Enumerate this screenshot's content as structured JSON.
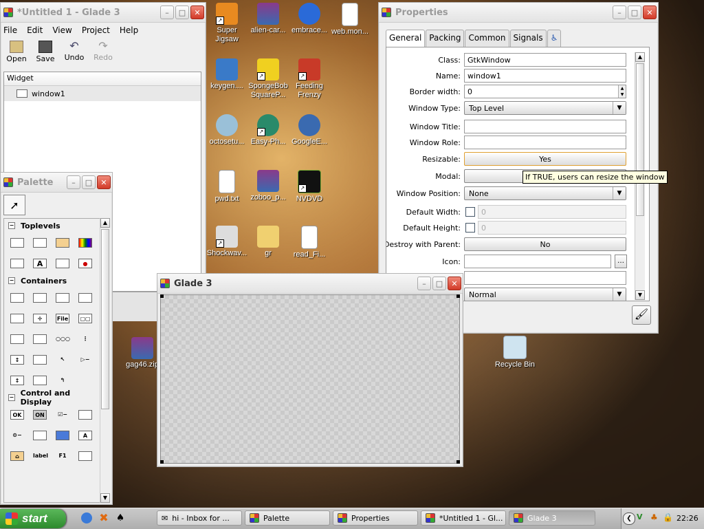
{
  "desktop": {
    "icons": [
      {
        "label": "Super Jigsaw",
        "x": 0
      },
      {
        "label": "alien-car...",
        "x": 0
      },
      {
        "label": "embrace...",
        "x": 0
      },
      {
        "label": "web.mon...",
        "x": 0
      },
      {
        "label": "keygen....",
        "x": 0
      },
      {
        "label": "SpongeBob SquareP...",
        "x": 0
      },
      {
        "label": "Feeding Frenzy",
        "x": 0
      },
      {
        "label": "octosetu...",
        "x": 0
      },
      {
        "label": "Easy-Ph...",
        "x": 0
      },
      {
        "label": "GoogleE...",
        "x": 0
      },
      {
        "label": "pwd.txt",
        "x": 0
      },
      {
        "label": "zoboo_p...",
        "x": 0
      },
      {
        "label": "NVDVD",
        "x": 0
      },
      {
        "label": "Shockwav...",
        "x": 0
      },
      {
        "label": "gr",
        "x": 0
      },
      {
        "label": "read_Fi...",
        "x": 0
      },
      {
        "label": "gag46.zip",
        "x": 0
      },
      {
        "label": "Recycle Bin",
        "x": 0
      }
    ]
  },
  "main_window": {
    "title": "*Untitled 1 - Glade 3",
    "menu": [
      "File",
      "Edit",
      "View",
      "Project",
      "Help"
    ],
    "toolbar": [
      "Open",
      "Save",
      "Undo",
      "Redo"
    ],
    "tree_header": "Widget",
    "tree_item": "window1"
  },
  "palette": {
    "title": "Palette",
    "sections": [
      "Toplevels",
      "Containers",
      "Control and Display"
    ],
    "file_label": "File",
    "ok_label": "OK",
    "on_label": "ON",
    "label_label": "label",
    "f1_label": "F1"
  },
  "properties": {
    "title": "Properties",
    "tabs": [
      "General",
      "Packing",
      "Common",
      "Signals"
    ],
    "rows": {
      "class_label": "Class:",
      "class_value": "GtkWindow",
      "name_label": "Name:",
      "name_value": "window1",
      "border_label": "Border width:",
      "border_value": "0",
      "wtype_label": "Window Type:",
      "wtype_value": "Top Level",
      "wtitle_label": "Window Title:",
      "wrole_label": "Window Role:",
      "resizable_label": "Resizable:",
      "resizable_value": "Yes",
      "modal_label": "Modal:",
      "wpos_label": "Window Position:",
      "wpos_value": "None",
      "dwidth_label": "Default Width:",
      "dwidth_value": "0",
      "dheight_label": "Default Height:",
      "dheight_value": "0",
      "destroy_label": "Destroy with Parent:",
      "destroy_value": "No",
      "icon_label": "Icon:",
      "partial_value": "Normal"
    },
    "tooltip": "If TRUE, users can resize the window"
  },
  "glade_window": {
    "title": "Glade 3"
  },
  "taskbar": {
    "start": "start",
    "buttons": [
      "hi - Inbox for ...",
      "Palette",
      "Properties",
      "*Untitled 1 - Gl...",
      "Glade 3"
    ],
    "clock": "22:26"
  }
}
